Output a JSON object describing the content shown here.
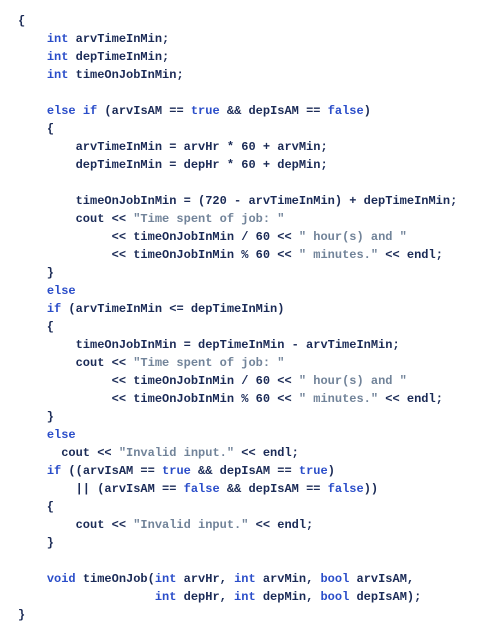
{
  "code": {
    "l1": "{",
    "l2": "    int arvTimeInMin;",
    "l2_kw": "int",
    "l2_id": " arvTimeInMin;",
    "l3_kw": "int",
    "l3_id": " depTimeInMin;",
    "l4_kw": "int",
    "l4_id": " timeOnJobInMin;",
    "l6_kw1": "else if",
    "l6_mid": " (arvIsAM == ",
    "l6_true": "true",
    "l6_mid2": " && depIsAM == ",
    "l6_false": "false",
    "l6_end": ")",
    "l7": "{",
    "l8": "        arvTimeInMin = arvHr * 60 + arvMin;",
    "l9": "        depTimeInMin = depHr * 60 + depMin;",
    "l11": "        timeOnJobInMin = (720 - arvTimeInMin) + depTimeInMin;",
    "l12_pre": "        cout << ",
    "l12_str": "\"Time spent of job: \"",
    "l13_pre": "             << timeOnJobInMin / 60 << ",
    "l13_str": "\" hour(s) and \"",
    "l14_pre": "             << timeOnJobInMin % 60 << ",
    "l14_str": "\" minutes.\"",
    "l14_end": " << endl;",
    "l15": "    }",
    "l16_kw": "else",
    "l17_kw": "if",
    "l17_rest": " (arvTimeInMin <= depTimeInMin)",
    "l18": "    {",
    "l19": "        timeOnJobInMin = depTimeInMin - arvTimeInMin;",
    "l20_pre": "        cout << ",
    "l20_str": "\"Time spent of job: \"",
    "l21_pre": "             << timeOnJobInMin / 60 << ",
    "l21_str": "\" hour(s) and \"",
    "l22_pre": "             << timeOnJobInMin % 60 << ",
    "l22_str": "\" minutes.\"",
    "l22_end": " << endl;",
    "l23": "    }",
    "l24_kw": "else",
    "l25_pre": "      cout << ",
    "l25_str": "\"Invalid input.\"",
    "l25_end": " << endl;",
    "l26_kw": "if",
    "l26_mid1": " ((arvIsAM == ",
    "l26_t1": "true",
    "l26_mid2": " && depIsAM == ",
    "l26_t2": "true",
    "l26_end": ")",
    "l27_mid1": "        || (arvIsAM == ",
    "l27_f1": "false",
    "l27_mid2": " && depIsAM == ",
    "l27_f2": "false",
    "l27_end": "))",
    "l28": "    {",
    "l29_pre": "        cout << ",
    "l29_str": "\"Invalid input.\"",
    "l29_end": " << endl;",
    "l30": "    }",
    "l32_kw": "void",
    "l32_mid": " timeOnJob(",
    "l32_int1": "int",
    "l32_p1": " arvHr, ",
    "l32_int2": "int",
    "l32_p2": " arvMin, ",
    "l32_bool1": "bool",
    "l32_p3": " arvIsAM,",
    "l33_pre": "                   ",
    "l33_int1": "int",
    "l33_p1": " depHr, ",
    "l33_int2": "int",
    "l33_p2": " depMin, ",
    "l33_bool1": "bool",
    "l33_p3": " depIsAM);",
    "l34": "}"
  }
}
